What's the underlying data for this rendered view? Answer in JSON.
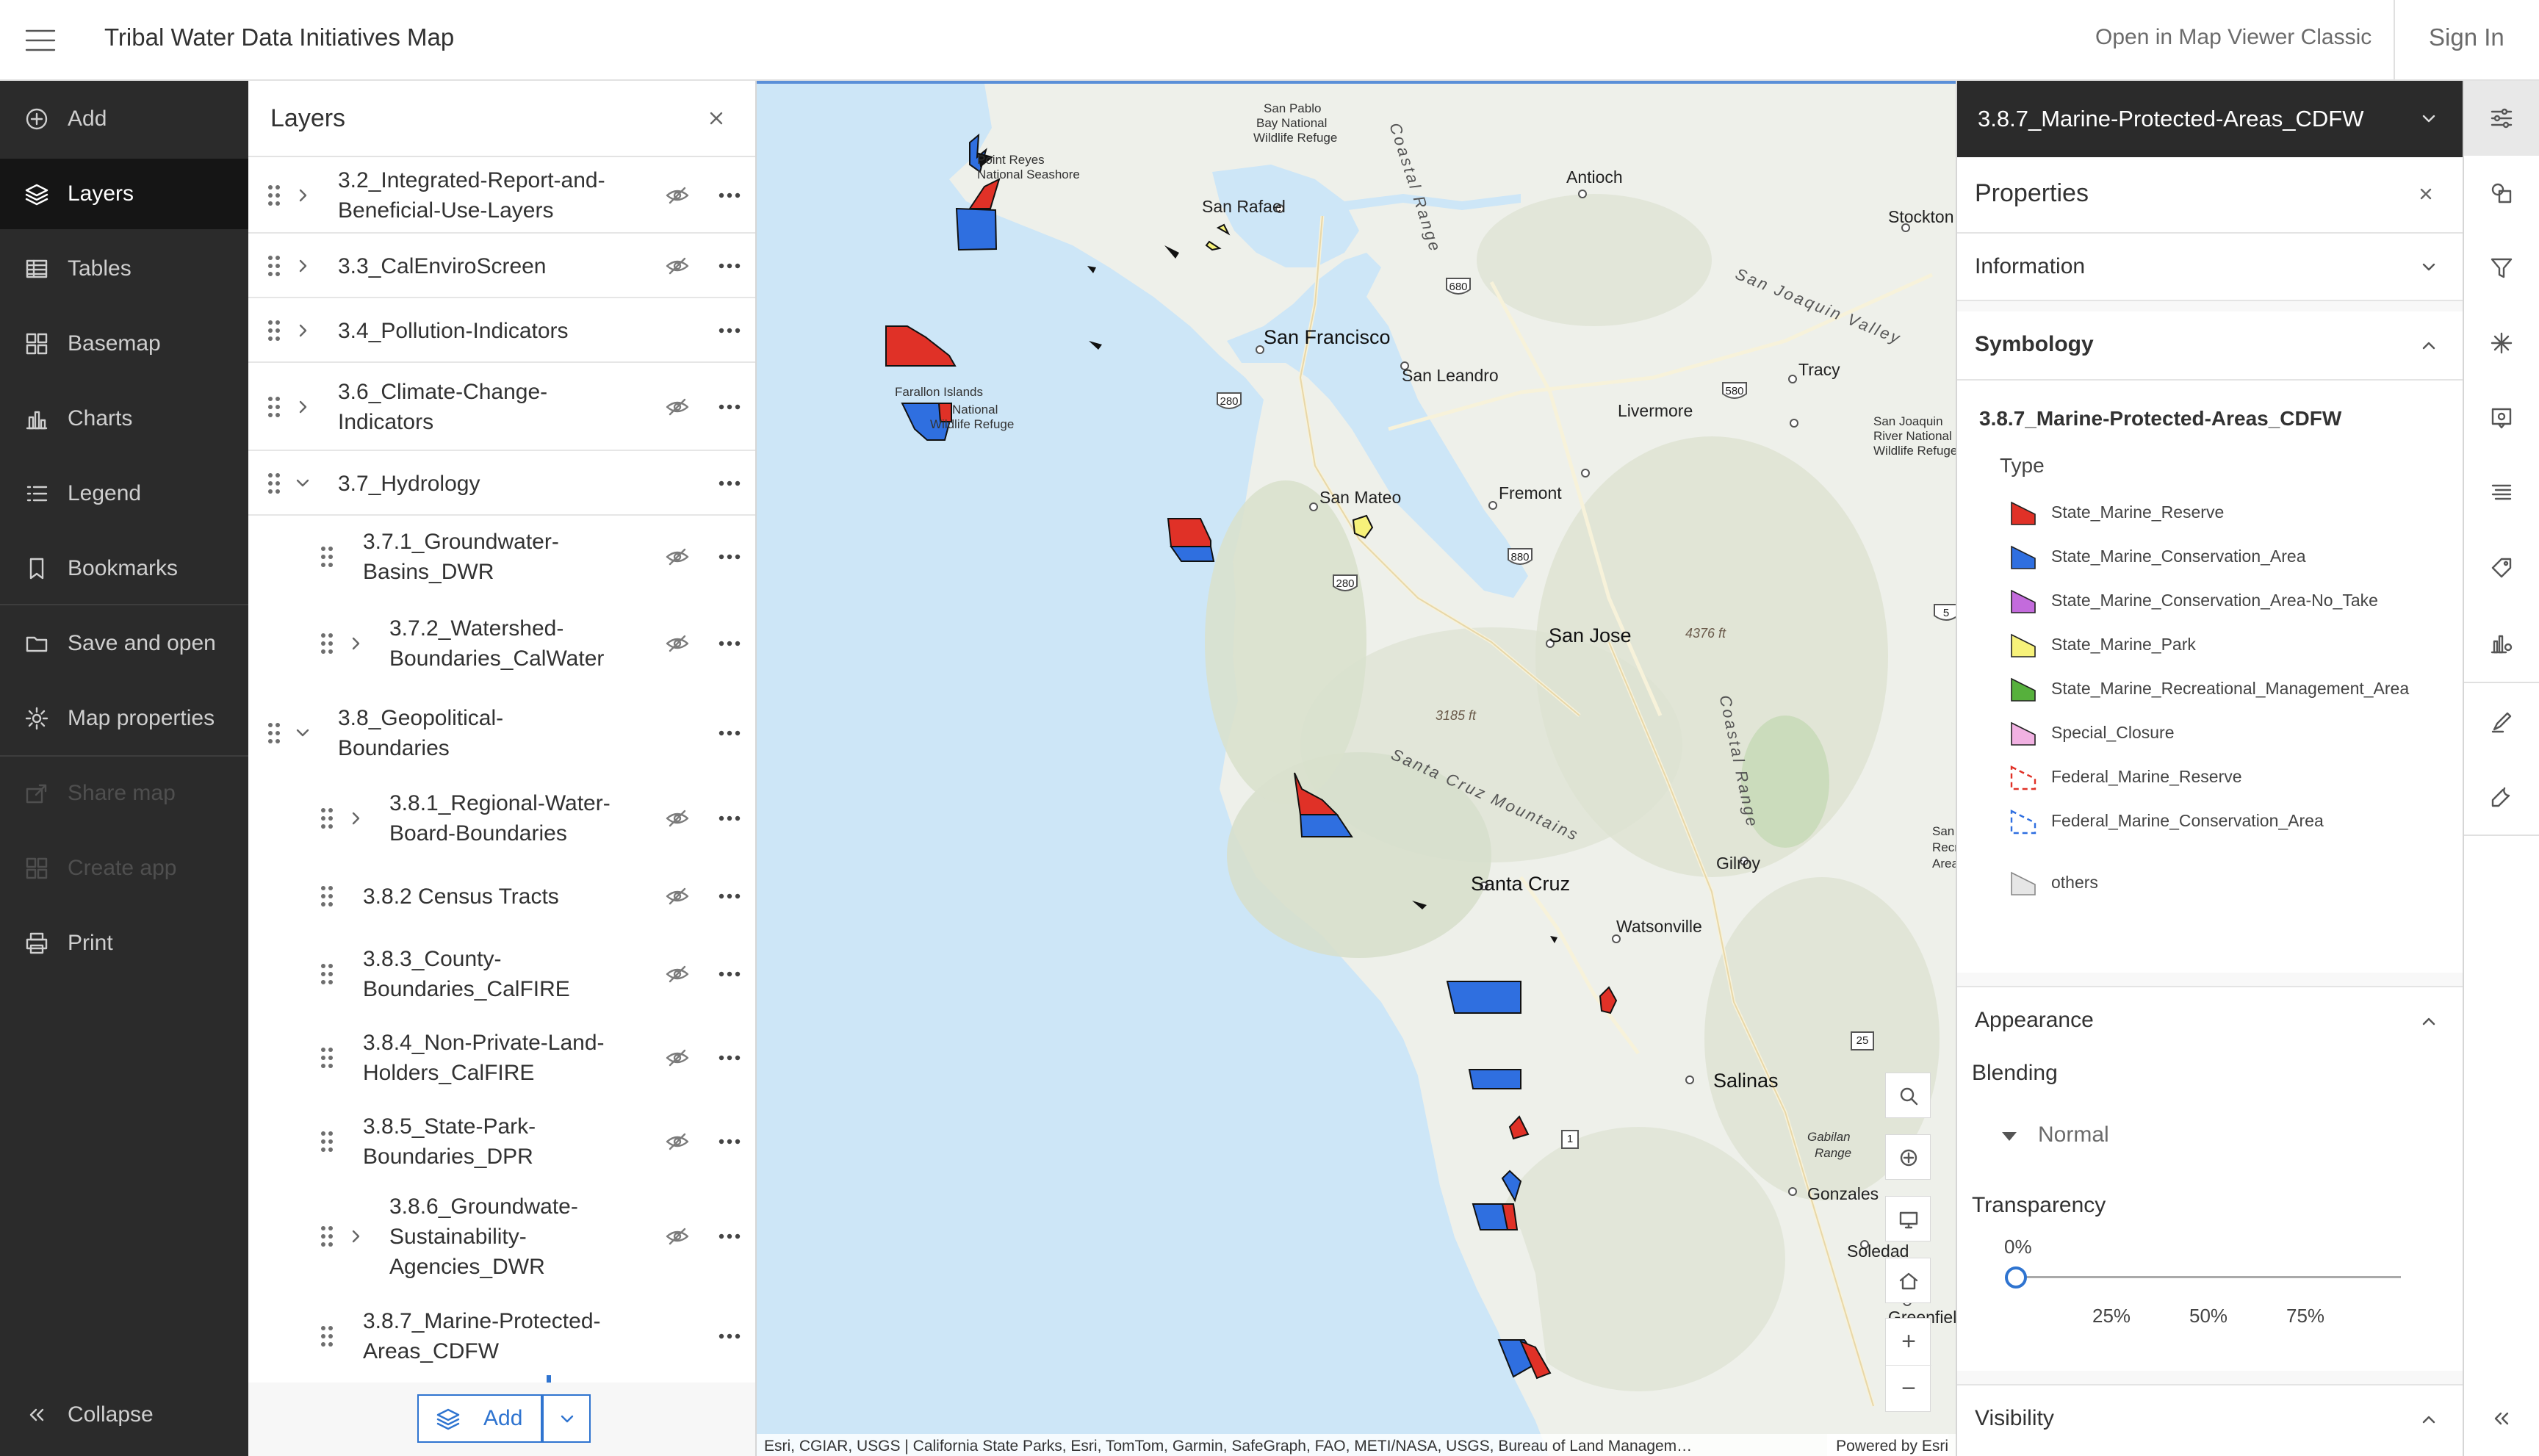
{
  "header": {
    "title": "Tribal Water Data Initiatives Map",
    "open_classic": "Open in Map Viewer Classic",
    "sign_in": "Sign In"
  },
  "nav": {
    "items": [
      {
        "label": "Add",
        "icon": "add-icon"
      },
      {
        "label": "Layers",
        "icon": "layers-icon",
        "active": true
      },
      {
        "label": "Tables",
        "icon": "table-icon"
      },
      {
        "label": "Basemap",
        "icon": "basemap-icon"
      },
      {
        "label": "Charts",
        "icon": "chart-icon"
      },
      {
        "label": "Legend",
        "icon": "legend-icon"
      },
      {
        "label": "Bookmarks",
        "icon": "bookmark-icon"
      },
      {
        "label": "Save and open",
        "icon": "folder-icon"
      },
      {
        "label": "Map properties",
        "icon": "gear-icon"
      },
      {
        "label": "Share map",
        "icon": "share-icon",
        "disabled": true
      },
      {
        "label": "Create app",
        "icon": "app-icon",
        "disabled": true
      },
      {
        "label": "Print",
        "icon": "print-icon"
      }
    ],
    "collapse": "Collapse"
  },
  "layers_panel": {
    "title": "Layers",
    "add_label": "Add",
    "layers": [
      {
        "line1": "3.2_Integrated-Report-and-",
        "line2": "Beneficial-Use-Layers"
      },
      {
        "line1": "3.3_CalEnviroScreen",
        "line2": ""
      },
      {
        "line1": "3.4_Pollution-Indicators",
        "line2": ""
      },
      {
        "line1": "3.6_Climate-Change-",
        "line2": "Indicators"
      },
      {
        "line1": "3.7_Hydrology",
        "line2": ""
      },
      {
        "line1": "3.7.1_Groundwater-",
        "line2": "Basins_DWR"
      },
      {
        "line1": "3.7.2_Watershed-",
        "line2": "Boundaries_CalWater"
      },
      {
        "line1": "3.8_Geopolitical-",
        "line2": "Boundaries"
      },
      {
        "line1": "3.8.1_Regional-Water-",
        "line2": "Board-Boundaries"
      },
      {
        "line1": "3.8.2 Census Tracts",
        "line2": ""
      },
      {
        "line1": "3.8.3_County-",
        "line2": "Boundaries_CalFIRE"
      },
      {
        "line1": "3.8.4_Non-Private-Land-",
        "line2": "Holders_CalFIRE"
      },
      {
        "line1": "3.8.5_State-Park-",
        "line2": "Boundaries_DPR"
      },
      {
        "line1": "3.8.6_Groundwate-",
        "line2": "Sustainability-",
        "line3": "Agencies_DWR"
      },
      {
        "line1": "3.8.7_Marine-Protected-",
        "line2": "Areas_CDFW"
      }
    ]
  },
  "map": {
    "labels": {
      "point_reyes": "Point Reyes",
      "national_seashore": "National Seashore",
      "san_pablo": "San Pablo",
      "bay_national": "Bay National",
      "wildlife_refuge": "Wildlife Refuge",
      "coastal_range_n": "Coastal Range",
      "antioch": "Antioch",
      "stockton": "Stockton",
      "san_rafael": "San Rafael",
      "san_joaquin_valley": "San Joaquin Valley",
      "san_francisco": "San Francisco",
      "san_leandro": "San Leandro",
      "tracy": "Tracy",
      "farallon_islands": "Farallon Islands",
      "farallon_national": "National",
      "farallon_refuge": "Wildlife Refuge",
      "livermore": "Livermore",
      "sj_river_1": "San Joaquin",
      "sj_river_2": "River National",
      "sj_river_3": "Wildlife Refuge",
      "san_mateo": "San Mateo",
      "fremont": "Fremont",
      "san_jose": "San Jose",
      "elev_4376": "4376 ft",
      "elev_3185": "3185 ft",
      "coastal_range_s": "Coastal Range",
      "santa_cruz_mountains": "Santa Cruz Mountains",
      "santa_cruz": "Santa Cruz",
      "gilroy": "Gilroy",
      "watsonville": "Watsonville",
      "san_1": "San",
      "san_2": "Recrea",
      "san_3": "Area",
      "salinas": "Salinas",
      "gabilan_range_1": "Gabilan",
      "gabilan_range_2": "Range",
      "gonzales": "Gonzales",
      "soledad": "Soledad",
      "greenfield": "Greenfield"
    },
    "highways": [
      "680",
      "580",
      "280",
      "280",
      "880",
      "5",
      "25",
      "1",
      "1",
      "1"
    ],
    "attribution": "Esri, CGIAR, USGS | California State Parks, Esri, TomTom, Garmin, SafeGraph, FAO, METI/NASA, USGS, Bureau of Land Managem…",
    "powered_by": "Powered by Esri"
  },
  "properties": {
    "layer_name": "3.8.7_Marine-Protected-Areas_CDFW",
    "title": "Properties",
    "information": "Information",
    "symbology": "Symbology",
    "symbology_layer": "3.8.7_Marine-Protected-Areas_CDFW",
    "type_label": "Type",
    "legend": [
      {
        "label": "State_Marine_Reserve",
        "fill": "#e03127",
        "stroke": "#222",
        "dashed": false
      },
      {
        "label": "State_Marine_Conservation_Area",
        "fill": "#2f6fe0",
        "stroke": "#222",
        "dashed": false
      },
      {
        "label": "State_Marine_Conservation_Area-No_Take",
        "fill": "#c36bdc",
        "stroke": "#222",
        "dashed": false
      },
      {
        "label": "State_Marine_Park",
        "fill": "#f7f27a",
        "stroke": "#222",
        "dashed": false
      },
      {
        "label": "State_Marine_Recreational_Management_Area",
        "fill": "#56b03c",
        "stroke": "#222",
        "dashed": false
      },
      {
        "label": "Special_Closure",
        "fill": "#f1b1e2",
        "stroke": "#222",
        "dashed": false
      },
      {
        "label": "Federal_Marine_Reserve",
        "fill": "none",
        "stroke": "#e03127",
        "dashed": true
      },
      {
        "label": "Federal_Marine_Conservation_Area",
        "fill": "none",
        "stroke": "#2f6fe0",
        "dashed": true
      },
      {
        "label": "others",
        "fill": "#e6e6e6",
        "stroke": "#888",
        "dashed": false
      }
    ],
    "appearance": "Appearance",
    "blending": "Blending",
    "blending_value": "Normal",
    "transparency": "Transparency",
    "transparency_value": "0%",
    "transparency_fraction": 0,
    "ticks": [
      "25%",
      "50%",
      "75%"
    ],
    "visibility": "Visibility"
  },
  "colors": {
    "accent": "#2f74d0",
    "nav_bg": "#2b2b2b",
    "reserve": "#e03127",
    "conservation": "#2f6fe0",
    "water": "#cce6f7",
    "land": "#eef0ea"
  }
}
